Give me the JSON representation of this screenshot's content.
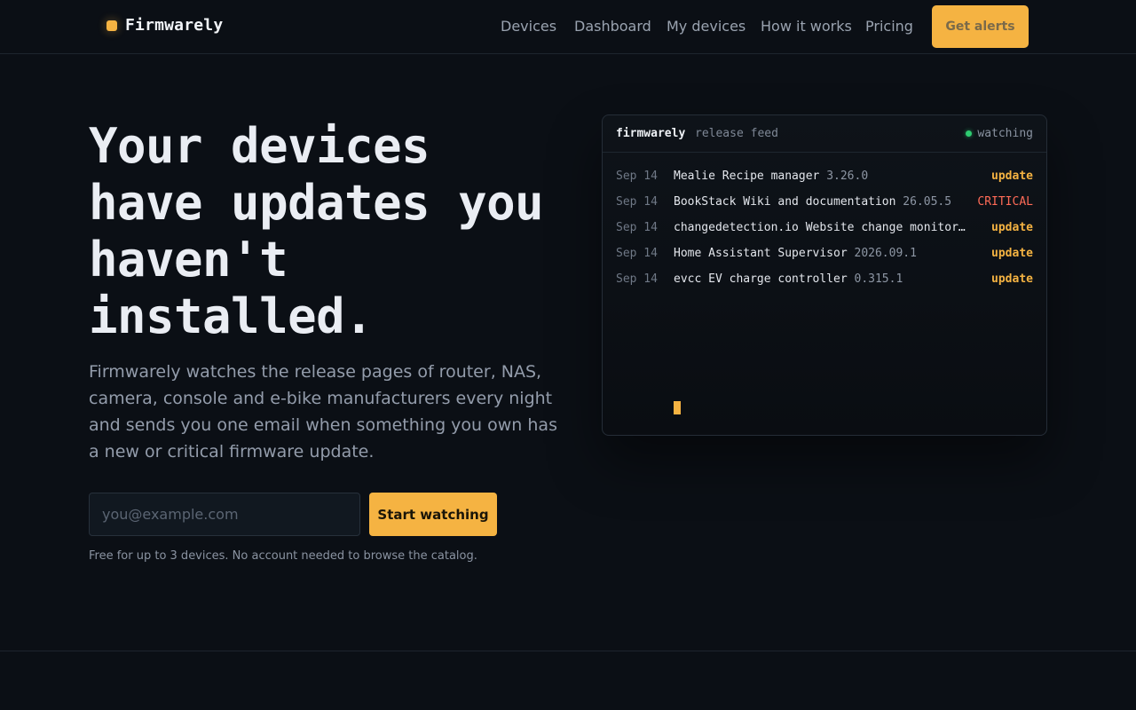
{
  "header": {
    "brand": "Firmwarely",
    "nav": [
      "Devices",
      "Dashboard",
      "My devices",
      "How it works",
      "Pricing"
    ],
    "cta": "Get alerts"
  },
  "hero": {
    "title_lines": [
      "Your devices",
      "have updates you",
      "haven't",
      "installed."
    ],
    "subtitle": "Firmwarely watches the release pages of router, NAS, camera, console and e-bike manufacturers every night and sends you one email when something you own has a new or critical firmware update.",
    "email_placeholder": "you@example.com",
    "cta": "Start watching",
    "fine_print": "Free for up to 3 devices. No account needed to browse the catalog."
  },
  "feed": {
    "name": "firmwarely",
    "label": "release feed",
    "status": "watching",
    "status_color": "#2ecc71",
    "rows": [
      {
        "date": "Sep 14",
        "name": "Mealie Recipe manager",
        "version": "3.26.0",
        "tag": "update"
      },
      {
        "date": "Sep 14",
        "name": "BookStack Wiki and documentation",
        "version": "26.05.5",
        "tag": "CRITICAL"
      },
      {
        "date": "Sep 14",
        "name": "changedetection.io Website change monitor…",
        "version": "",
        "tag": "update"
      },
      {
        "date": "Sep 14",
        "name": "Home Assistant Supervisor",
        "version": "2026.09.1",
        "tag": "update"
      },
      {
        "date": "Sep 14",
        "name": "evcc EV charge controller",
        "version": "0.315.1",
        "tag": "update"
      }
    ]
  },
  "colors": {
    "accent": "#f5b342",
    "critical": "#ff6b57",
    "background": "#0b0f15"
  }
}
